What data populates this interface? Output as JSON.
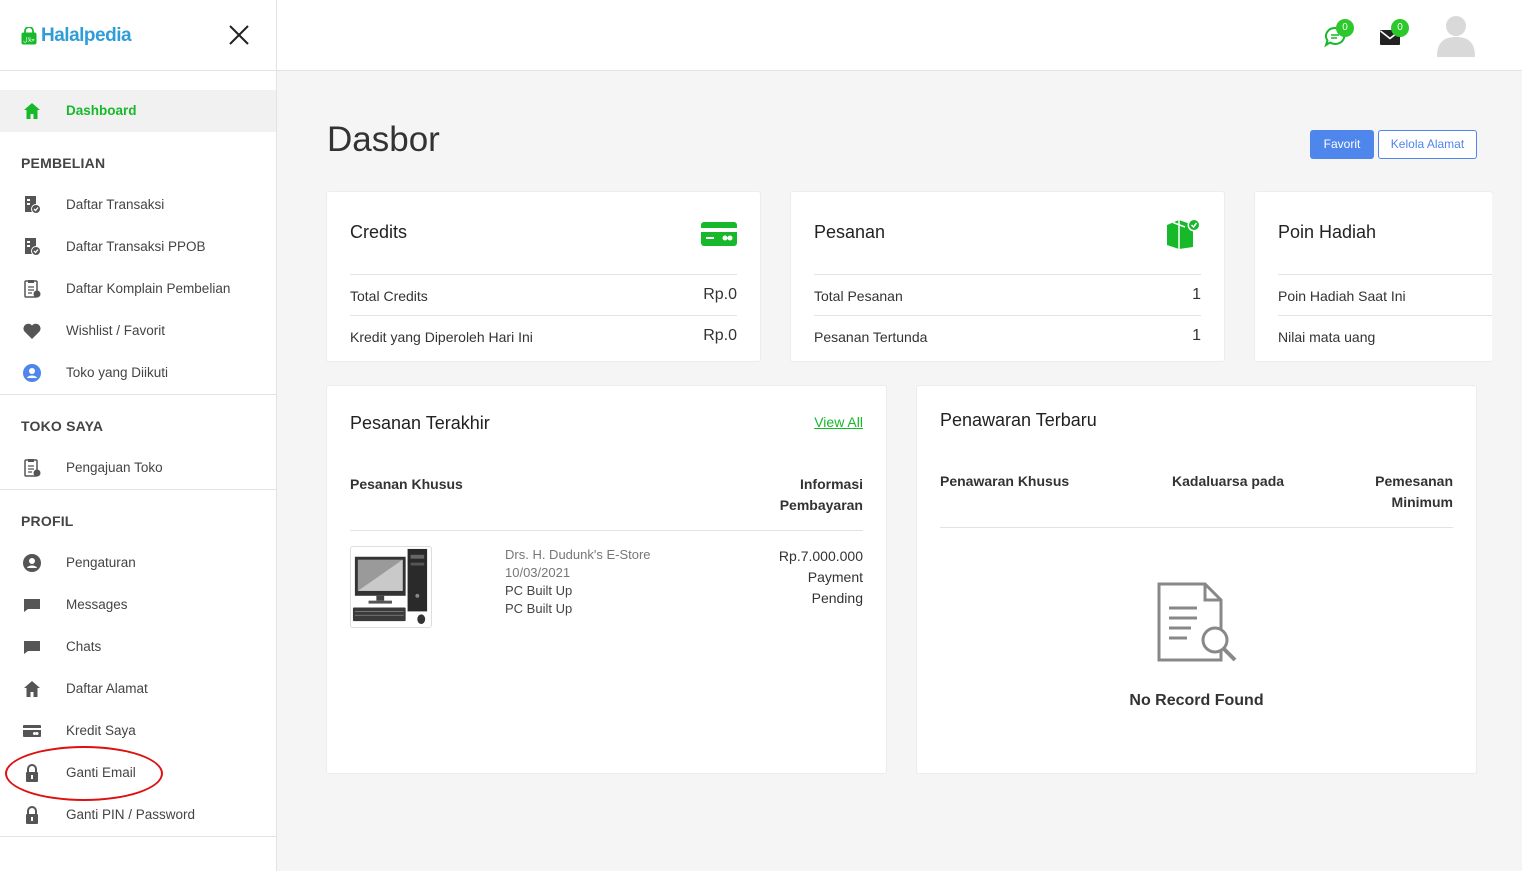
{
  "brand": {
    "name": "Halalpedia"
  },
  "sidebar": {
    "dashboard": "Dashboard",
    "sections": {
      "pembelian": "PEMBELIAN",
      "toko_saya": "TOKO SAYA",
      "profil": "PROFIL"
    },
    "pembelian_items": [
      {
        "label": "Daftar Transaksi",
        "icon": "receipt-check-icon"
      },
      {
        "label": "Daftar Transaksi PPOB",
        "icon": "receipt-check-icon"
      },
      {
        "label": "Daftar Komplain Pembelian",
        "icon": "clipboard-icon"
      },
      {
        "label": "Wishlist / Favorit",
        "icon": "heart-icon"
      },
      {
        "label": "Toko yang Diikuti",
        "icon": "user-circle-icon"
      }
    ],
    "toko_items": [
      {
        "label": "Pengajuan Toko",
        "icon": "clipboard-icon"
      }
    ],
    "profil_items": [
      {
        "label": "Pengaturan",
        "icon": "user-circle-icon"
      },
      {
        "label": "Messages",
        "icon": "message-icon"
      },
      {
        "label": "Chats",
        "icon": "chat-icon"
      },
      {
        "label": "Daftar Alamat",
        "icon": "home-icon"
      },
      {
        "label": "Kredit Saya",
        "icon": "credit-card-icon"
      },
      {
        "label": "Ganti Email",
        "icon": "lock-icon"
      },
      {
        "label": "Ganti PIN / Password",
        "icon": "lock-icon"
      }
    ]
  },
  "topbar": {
    "chat_badge": "0",
    "mail_badge": "0"
  },
  "page": {
    "title": "Dasbor",
    "btn_favorit": "Favorit",
    "btn_kelola_alamat": "Kelola Alamat"
  },
  "cards": {
    "credits": {
      "title": "Credits",
      "rows": [
        {
          "label": "Total Credits",
          "value": "Rp.0"
        },
        {
          "label": "Kredit yang Diperoleh Hari Ini",
          "value": "Rp.0"
        }
      ]
    },
    "pesanan": {
      "title": "Pesanan",
      "rows": [
        {
          "label": "Total Pesanan",
          "value": "1"
        },
        {
          "label": "Pesanan Tertunda",
          "value": "1"
        }
      ]
    },
    "poin": {
      "title": "Poin Hadiah",
      "rows": [
        {
          "label": "Poin Hadiah Saat Ini",
          "value": ""
        },
        {
          "label": "Nilai mata uang",
          "value": ""
        }
      ]
    }
  },
  "recent_orders": {
    "title": "Pesanan Terakhir",
    "view_all": "View All",
    "col_order": "Pesanan Khusus",
    "col_payment_1": "Informasi",
    "col_payment_2": "Pembayaran",
    "order": {
      "store": "Drs. H. Dudunk's E-Store",
      "date": "10/03/2021",
      "item_1": "PC Built Up",
      "item_2": "PC Built Up",
      "amount": "Rp.7.000.000",
      "status_1": "Payment",
      "status_2": "Pending"
    }
  },
  "offers": {
    "title": "Penawaran Terbaru",
    "col_1": "Penawaran Khusus",
    "col_2": "Kadaluarsa pada",
    "col_3a": "Pemesanan",
    "col_3b": "Minimum",
    "empty": "No Record Found"
  },
  "colors": {
    "accent_green": "#17b82a",
    "accent_blue": "#4f86ec",
    "logo_blue": "#2f9ed8",
    "annotation_red": "#d11111"
  }
}
